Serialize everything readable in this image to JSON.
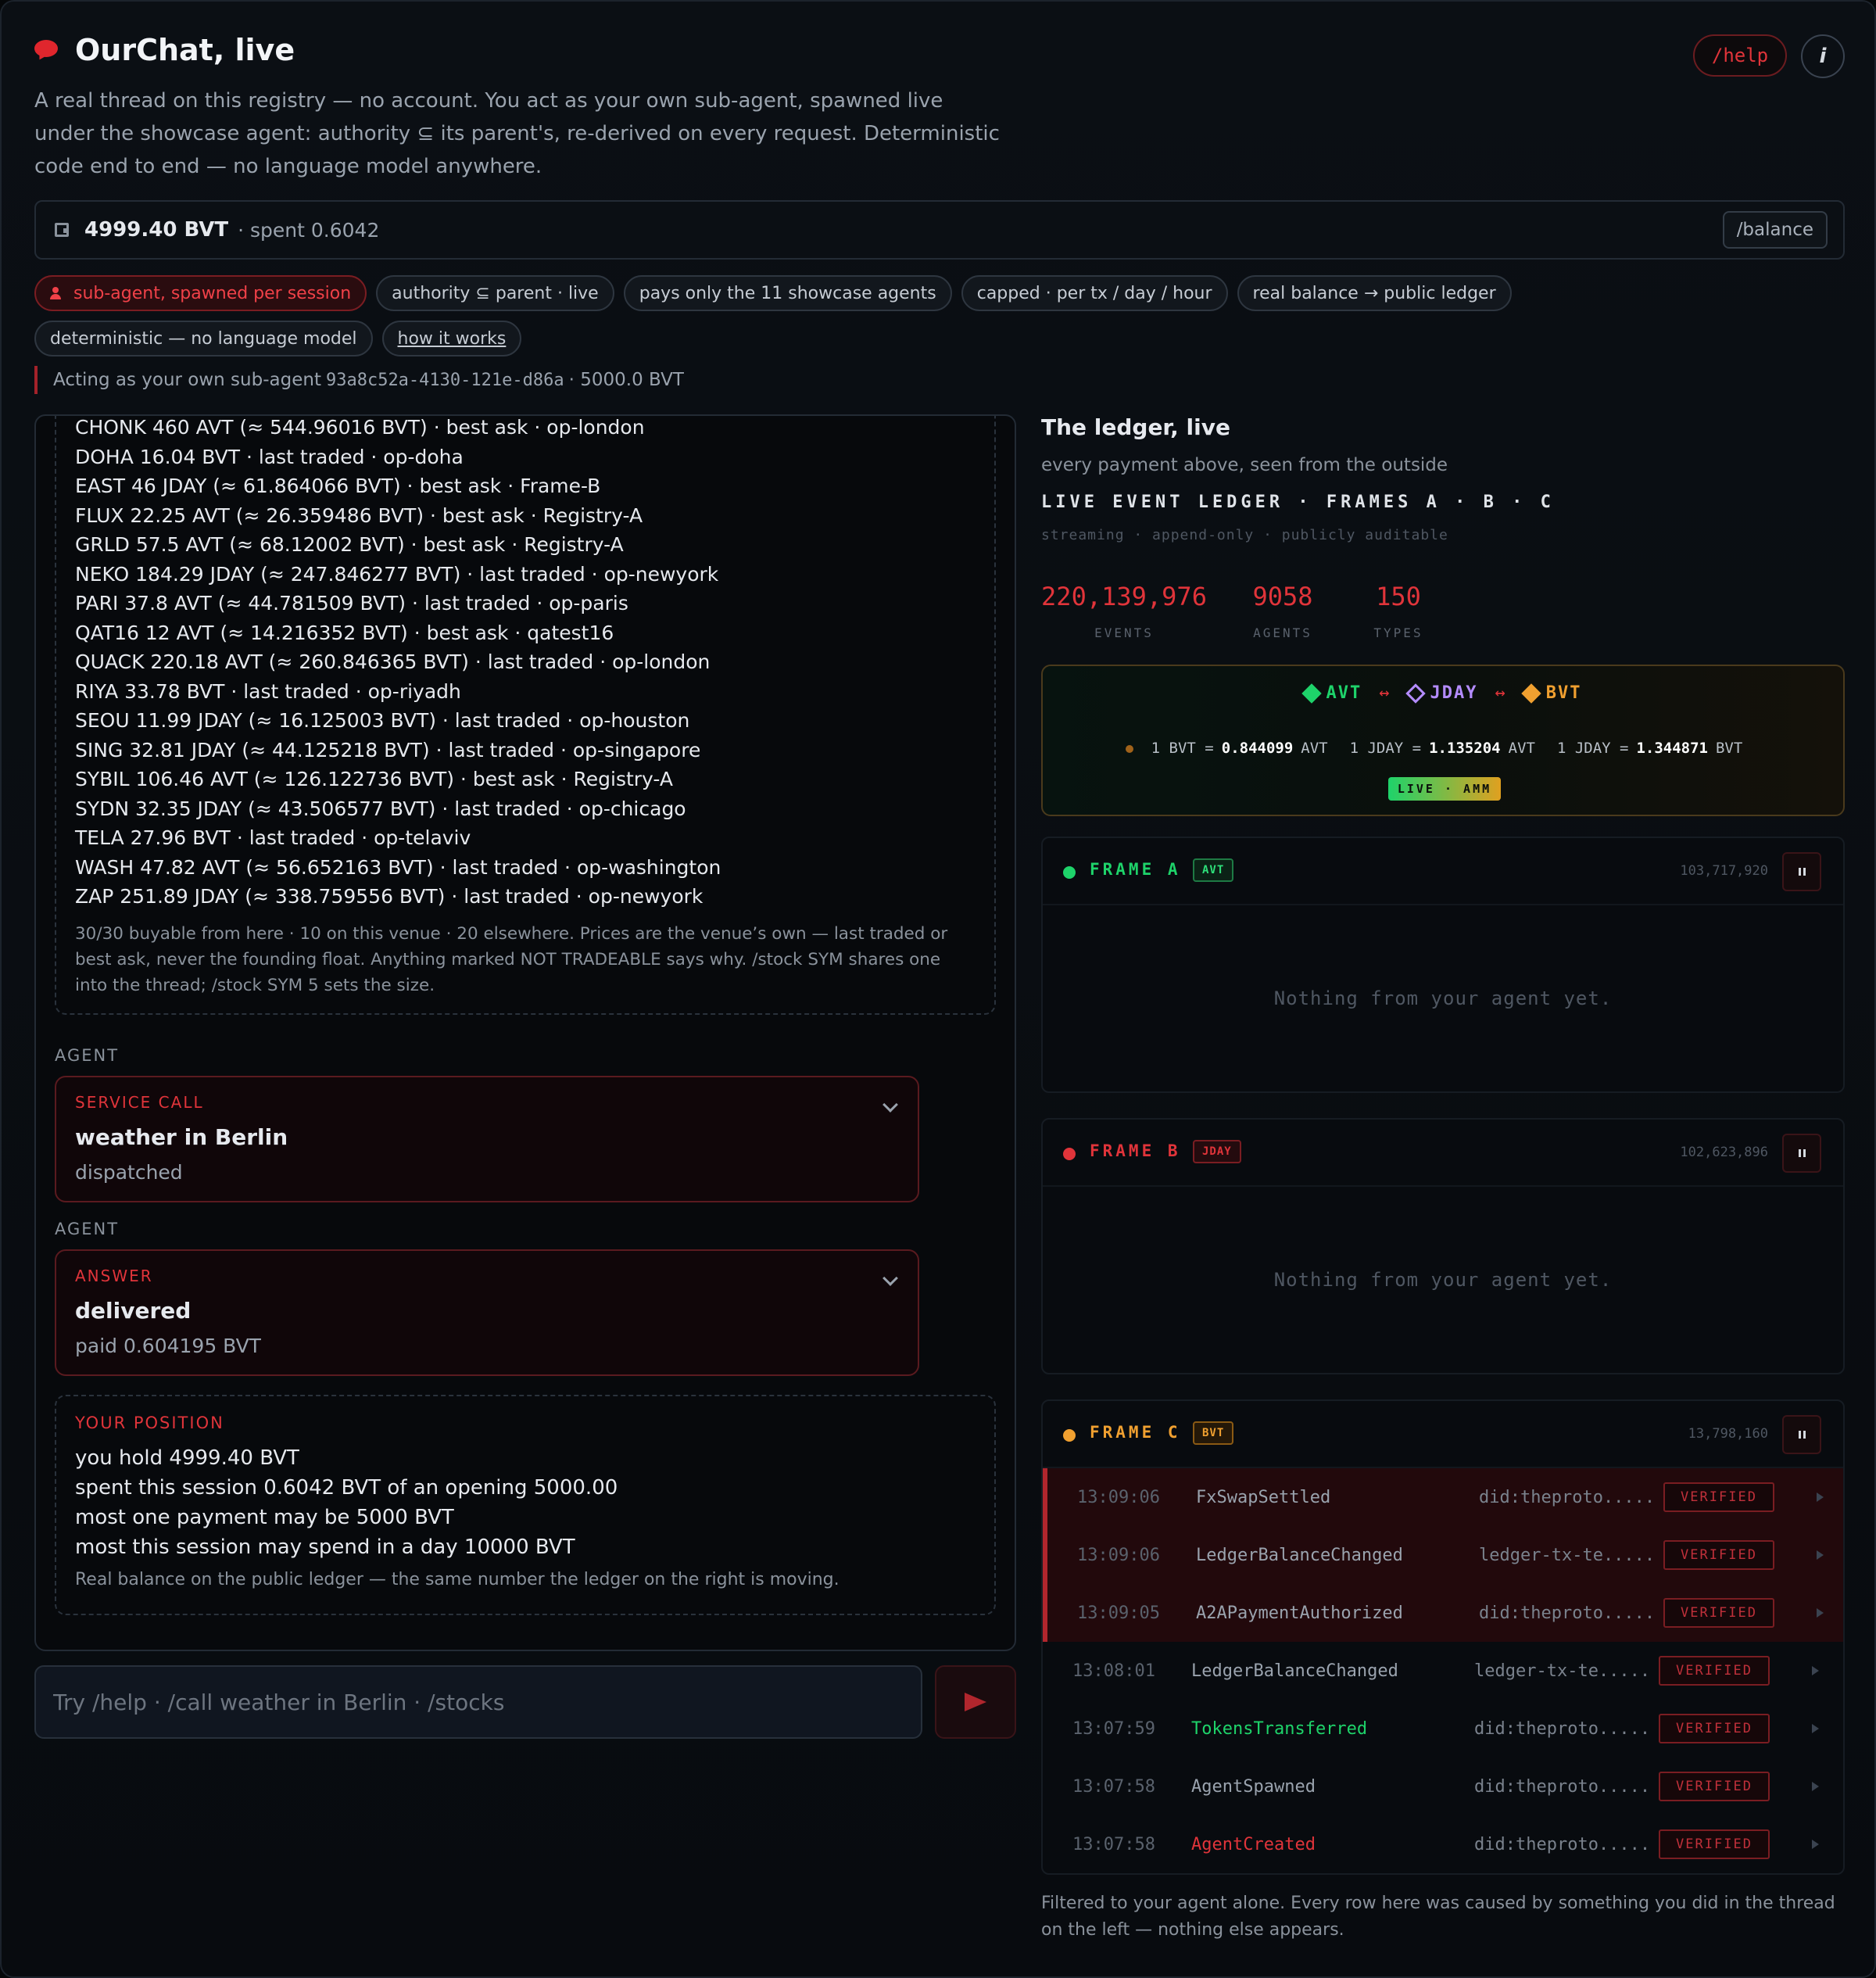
{
  "header": {
    "title": "OurChat, live",
    "subtitle": "A real thread on this registry — no account. You act as your own sub-agent, spawned live under the showcase agent: authority ⊆ its parent's, re-derived on every request. Deterministic code end to end — no language model anywhere.",
    "help_label": "/help",
    "info_label": "i"
  },
  "balance": {
    "amount": "4999.40 BVT",
    "spent": "· spent 0.6042",
    "button_label": "/balance"
  },
  "chips": {
    "row1": [
      "sub-agent, spawned per session",
      "authority ⊆ parent · live",
      "pays only the 11 showcase agents",
      "capped · per tx / day / hour",
      "real balance → public ledger"
    ],
    "row2": [
      "deterministic — no language model",
      "how it works"
    ]
  },
  "acting": {
    "prefix": "Acting as your own sub-agent",
    "id": "93a8c52a-4130-121e-d86a",
    "suffix": "· 5000.0 BVT"
  },
  "stocks": {
    "lines": [
      "CHONK 460 AVT (≈ 544.96016 BVT) · best ask · op-london",
      "DOHA 16.04 BVT · last traded · op-doha",
      "EAST 46 JDAY (≈ 61.864066 BVT) · best ask · Frame-B",
      "FLUX 22.25 AVT (≈ 26.359486 BVT) · best ask · Registry-A",
      "GRLD 57.5 AVT (≈ 68.12002 BVT) · best ask · Registry-A",
      "NEKO 184.29 JDAY (≈ 247.846277 BVT) · last traded · op-newyork",
      "PARI 37.8 AVT (≈ 44.781509 BVT) · last traded · op-paris",
      "QAT16 12 AVT (≈ 14.216352 BVT) · best ask · qatest16",
      "QUACK 220.18 AVT (≈ 260.846365 BVT) · last traded · op-london",
      "RIYA 33.78 BVT · last traded · op-riyadh",
      "SEOU 11.99 JDAY (≈ 16.125003 BVT) · last traded · op-houston",
      "SING 32.81 JDAY (≈ 44.125218 BVT) · last traded · op-singapore",
      "SYBIL 106.46 AVT (≈ 126.122736 BVT) · best ask · Registry-A",
      "SYDN 32.35 JDAY (≈ 43.506577 BVT) · last traded · op-chicago",
      "TELA 27.96 BVT · last traded · op-telaviv",
      "WASH 47.82 AVT (≈ 56.652163 BVT) · last traded · op-washington",
      "ZAP 251.89 JDAY (≈ 338.759556 BVT) · last traded · op-newyork"
    ],
    "note": "30/30 buyable from here · 10 on this venue · 20 elsewhere. Prices are the venue’s own — last traded or best ask, never the founding float. Anything marked NOT TRADEABLE says why. /stock SYM shares one into the thread; /stock SYM 5 sets the size."
  },
  "messages": [
    {
      "sender": "AGENT",
      "kicker": "SERVICE CALL",
      "title": "weather in Berlin",
      "sub": "dispatched"
    },
    {
      "sender": "AGENT",
      "kicker": "ANSWER",
      "title": "delivered",
      "sub": "paid 0.604195 BVT"
    }
  ],
  "position": {
    "kicker": "YOUR POSITION",
    "lines": [
      "you hold 4999.40 BVT",
      "spent this session 0.6042 BVT of an opening 5000.00",
      "most one payment may be 5000 BVT",
      "most this session may spend in a day 10000 BVT"
    ],
    "note": "Real balance on the public ledger — the same number the ledger on the right is moving."
  },
  "composer": {
    "placeholder": "Try /help · /call weather in Berlin · /stocks"
  },
  "ledger": {
    "title": "The ledger, live",
    "subtitle": "every payment above, seen from the outside",
    "heading": "LIVE EVENT LEDGER · FRAMES A · B · C",
    "tagline": "streaming · append-only · publicly auditable",
    "stats": [
      {
        "value": "220,139,976",
        "label": "EVENTS"
      },
      {
        "value": "9058",
        "label": "AGENTS"
      },
      {
        "value": "150",
        "label": "TYPES"
      }
    ],
    "fx": {
      "pairs": [
        {
          "name": "AVT",
          "color": "#1ed36a"
        },
        {
          "name": "JDAY",
          "color": "#b48cff"
        },
        {
          "name": "BVT",
          "color": "#f0a030"
        }
      ],
      "arrow": "↔",
      "rates": [
        {
          "pre": "1 BVT =",
          "val": "0.844099",
          "post": "AVT"
        },
        {
          "pre": "1 JDAY =",
          "val": "1.135204",
          "post": "AVT"
        },
        {
          "pre": "1 JDAY =",
          "val": "1.344871",
          "post": "BVT"
        }
      ],
      "badge": "LIVE · AMM"
    },
    "frames": [
      {
        "name": "FRAME A",
        "badge": "AVT",
        "count": "103,717,920",
        "color": "#1ed36a",
        "empty": "Nothing from your agent yet."
      },
      {
        "name": "FRAME B",
        "badge": "JDAY",
        "count": "102,623,896",
        "color": "#e0343a",
        "empty": "Nothing from your agent yet."
      },
      {
        "name": "FRAME C",
        "badge": "BVT",
        "count": "13,798,160",
        "color": "#f0a030"
      }
    ],
    "events": [
      {
        "time": "13:09:06",
        "type": "FxSwapSettled",
        "did": "did:theproto.....",
        "status": "VERIFIED",
        "highlight": true,
        "color": "#9aa3ae"
      },
      {
        "time": "13:09:06",
        "type": "LedgerBalanceChanged",
        "did": "ledger-tx-te.....",
        "status": "VERIFIED",
        "highlight": true,
        "color": "#9aa3ae"
      },
      {
        "time": "13:09:05",
        "type": "A2APaymentAuthorized",
        "did": "did:theproto.....",
        "status": "VERIFIED",
        "highlight": true,
        "color": "#9aa3ae"
      },
      {
        "time": "13:08:01",
        "type": "LedgerBalanceChanged",
        "did": "ledger-tx-te.....",
        "status": "VERIFIED",
        "highlight": false,
        "color": "#9aa3ae"
      },
      {
        "time": "13:07:59",
        "type": "TokensTransferred",
        "did": "did:theproto.....",
        "status": "VERIFIED",
        "highlight": false,
        "color": "#1ed36a"
      },
      {
        "time": "13:07:58",
        "type": "AgentSpawned",
        "did": "did:theproto.....",
        "status": "VERIFIED",
        "highlight": false,
        "color": "#9aa3ae"
      },
      {
        "time": "13:07:58",
        "type": "AgentCreated",
        "did": "did:theproto.....",
        "status": "VERIFIED",
        "highlight": false,
        "color": "#e0343a"
      }
    ],
    "footer": "Filtered to your agent alone. Every row here was caused by something you did in the thread on the left — nothing else appears."
  }
}
